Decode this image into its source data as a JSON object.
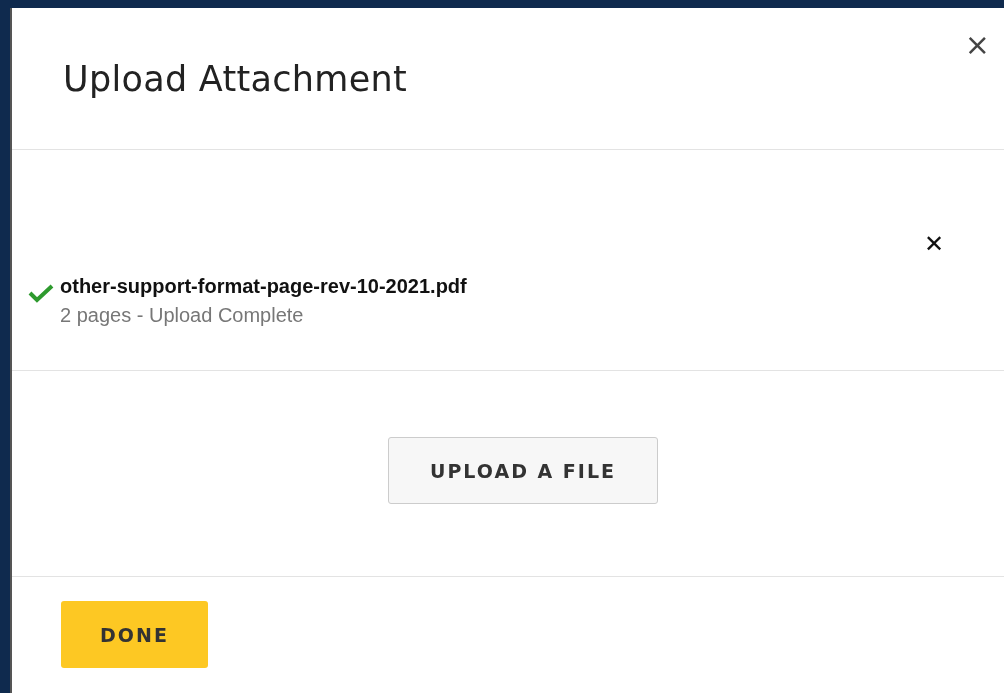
{
  "dialog": {
    "title": "Upload Attachment",
    "close": "×"
  },
  "files": [
    {
      "name": "other-support-format-page-rev-10-2021.pdf",
      "detail": "2 pages - Upload Complete",
      "complete": true,
      "remove": "✕"
    }
  ],
  "upload_button": "UPLOAD A FILE",
  "done_button": "DONE"
}
